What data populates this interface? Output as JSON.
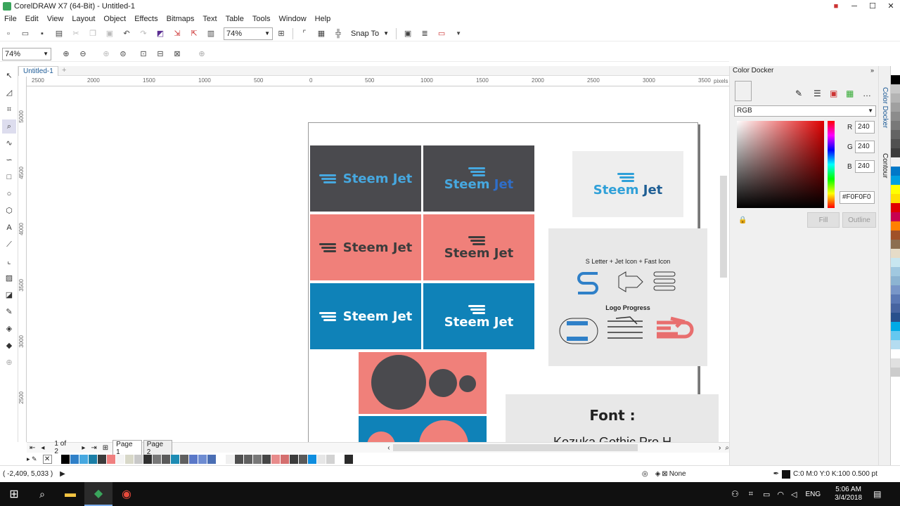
{
  "window": {
    "title": "CorelDRAW X7 (64-Bit) - Untitled-1"
  },
  "menu": [
    "File",
    "Edit",
    "View",
    "Layout",
    "Object",
    "Effects",
    "Bitmaps",
    "Text",
    "Table",
    "Tools",
    "Window",
    "Help"
  ],
  "toolbar": {
    "zoom": "74%",
    "snap_to": "Snap To"
  },
  "toolbar2": {
    "zoom": "74%"
  },
  "document": {
    "tab": "Untitled-1"
  },
  "ruler": {
    "unit": "pixels",
    "h_labels": [
      "2500",
      "2000",
      "1500",
      "1000",
      "500",
      "0",
      "500",
      "1000",
      "1500",
      "2000",
      "2500",
      "3000",
      "3500"
    ],
    "v_labels": [
      "5000",
      "4500",
      "4000",
      "3500",
      "3000",
      "2500"
    ]
  },
  "artwork": {
    "logo_text": [
      "Steem",
      "Jet"
    ],
    "components_title": "S Letter  +  Jet Icon + Fast Icon",
    "progress_title": "Logo Progress",
    "font_title": "Font :",
    "font_name": "Kozuka Gothic Pro H"
  },
  "page_nav": {
    "counter": "1 of 2",
    "pages": [
      "Page 1",
      "Page 2"
    ]
  },
  "status": {
    "coords": "( -2,409, 5,033 )",
    "fill": "None",
    "outline": "C:0 M:0 Y:0 K:100  0.500 pt"
  },
  "docker": {
    "title": "Color Docker",
    "model": "RGB",
    "r_label": "R",
    "g_label": "G",
    "b_label": "B",
    "r": "240",
    "g": "240",
    "b": "240",
    "hex": "#F0F0F0",
    "fill_button": "Fill",
    "outline_button": "Outline",
    "side_tabs": [
      "Color Docker",
      "Contour"
    ]
  },
  "taskbar": {
    "lang": "ENG",
    "time": "5:06 AM",
    "date": "3/4/2018"
  },
  "colors": {
    "dark": "#4a4a4e",
    "pink": "#f0807a",
    "blue": "#0f82b8",
    "light": "#e8e8e8",
    "palette_bottom": [
      "#ffffff",
      "#000000",
      "#2f80c8",
      "#46a8e0",
      "#1a7ea6",
      "#3c3c3c",
      "#f08080",
      "#f4f4f4",
      "#d8d8c8",
      "#c8c8c8",
      "#303030",
      "#787878",
      "#5a5a5a",
      "#1e8cb4",
      "#606060",
      "#5a78c8",
      "#6e8cd2",
      "#4a6eb4",
      "#ffffff",
      "#f0f0f0",
      "#505050",
      "#606060",
      "#787878",
      "#464646",
      "#e88c8c",
      "#d46e6e",
      "#3c3c3c",
      "#5a5a5a",
      "#0e8ee0",
      "#e6e6e6",
      "#d2d2d2",
      "#ffffff",
      "#2a2a2a"
    ],
    "palette_right": [
      "#ffffff",
      "#000000",
      "#c8c8c8",
      "#b4b4b4",
      "#a0a0a0",
      "#8c8c8c",
      "#787878",
      "#646464",
      "#505050",
      "#3c3c3c",
      "#f0f0f0",
      "#0078c8",
      "#00a0e0",
      "#ffff00",
      "#ffe000",
      "#e00000",
      "#c80050",
      "#ff8000",
      "#a05028",
      "#8c6e50",
      "#e6dcc8",
      "#c8e6f0",
      "#a0c8e0",
      "#8cb4d2",
      "#7896c8",
      "#5a78b4",
      "#4664a0",
      "#28508c",
      "#00aae6",
      "#64c8f0",
      "#b4dcf0",
      "#ffffff",
      "#e0e0e0",
      "#cccccc"
    ]
  }
}
